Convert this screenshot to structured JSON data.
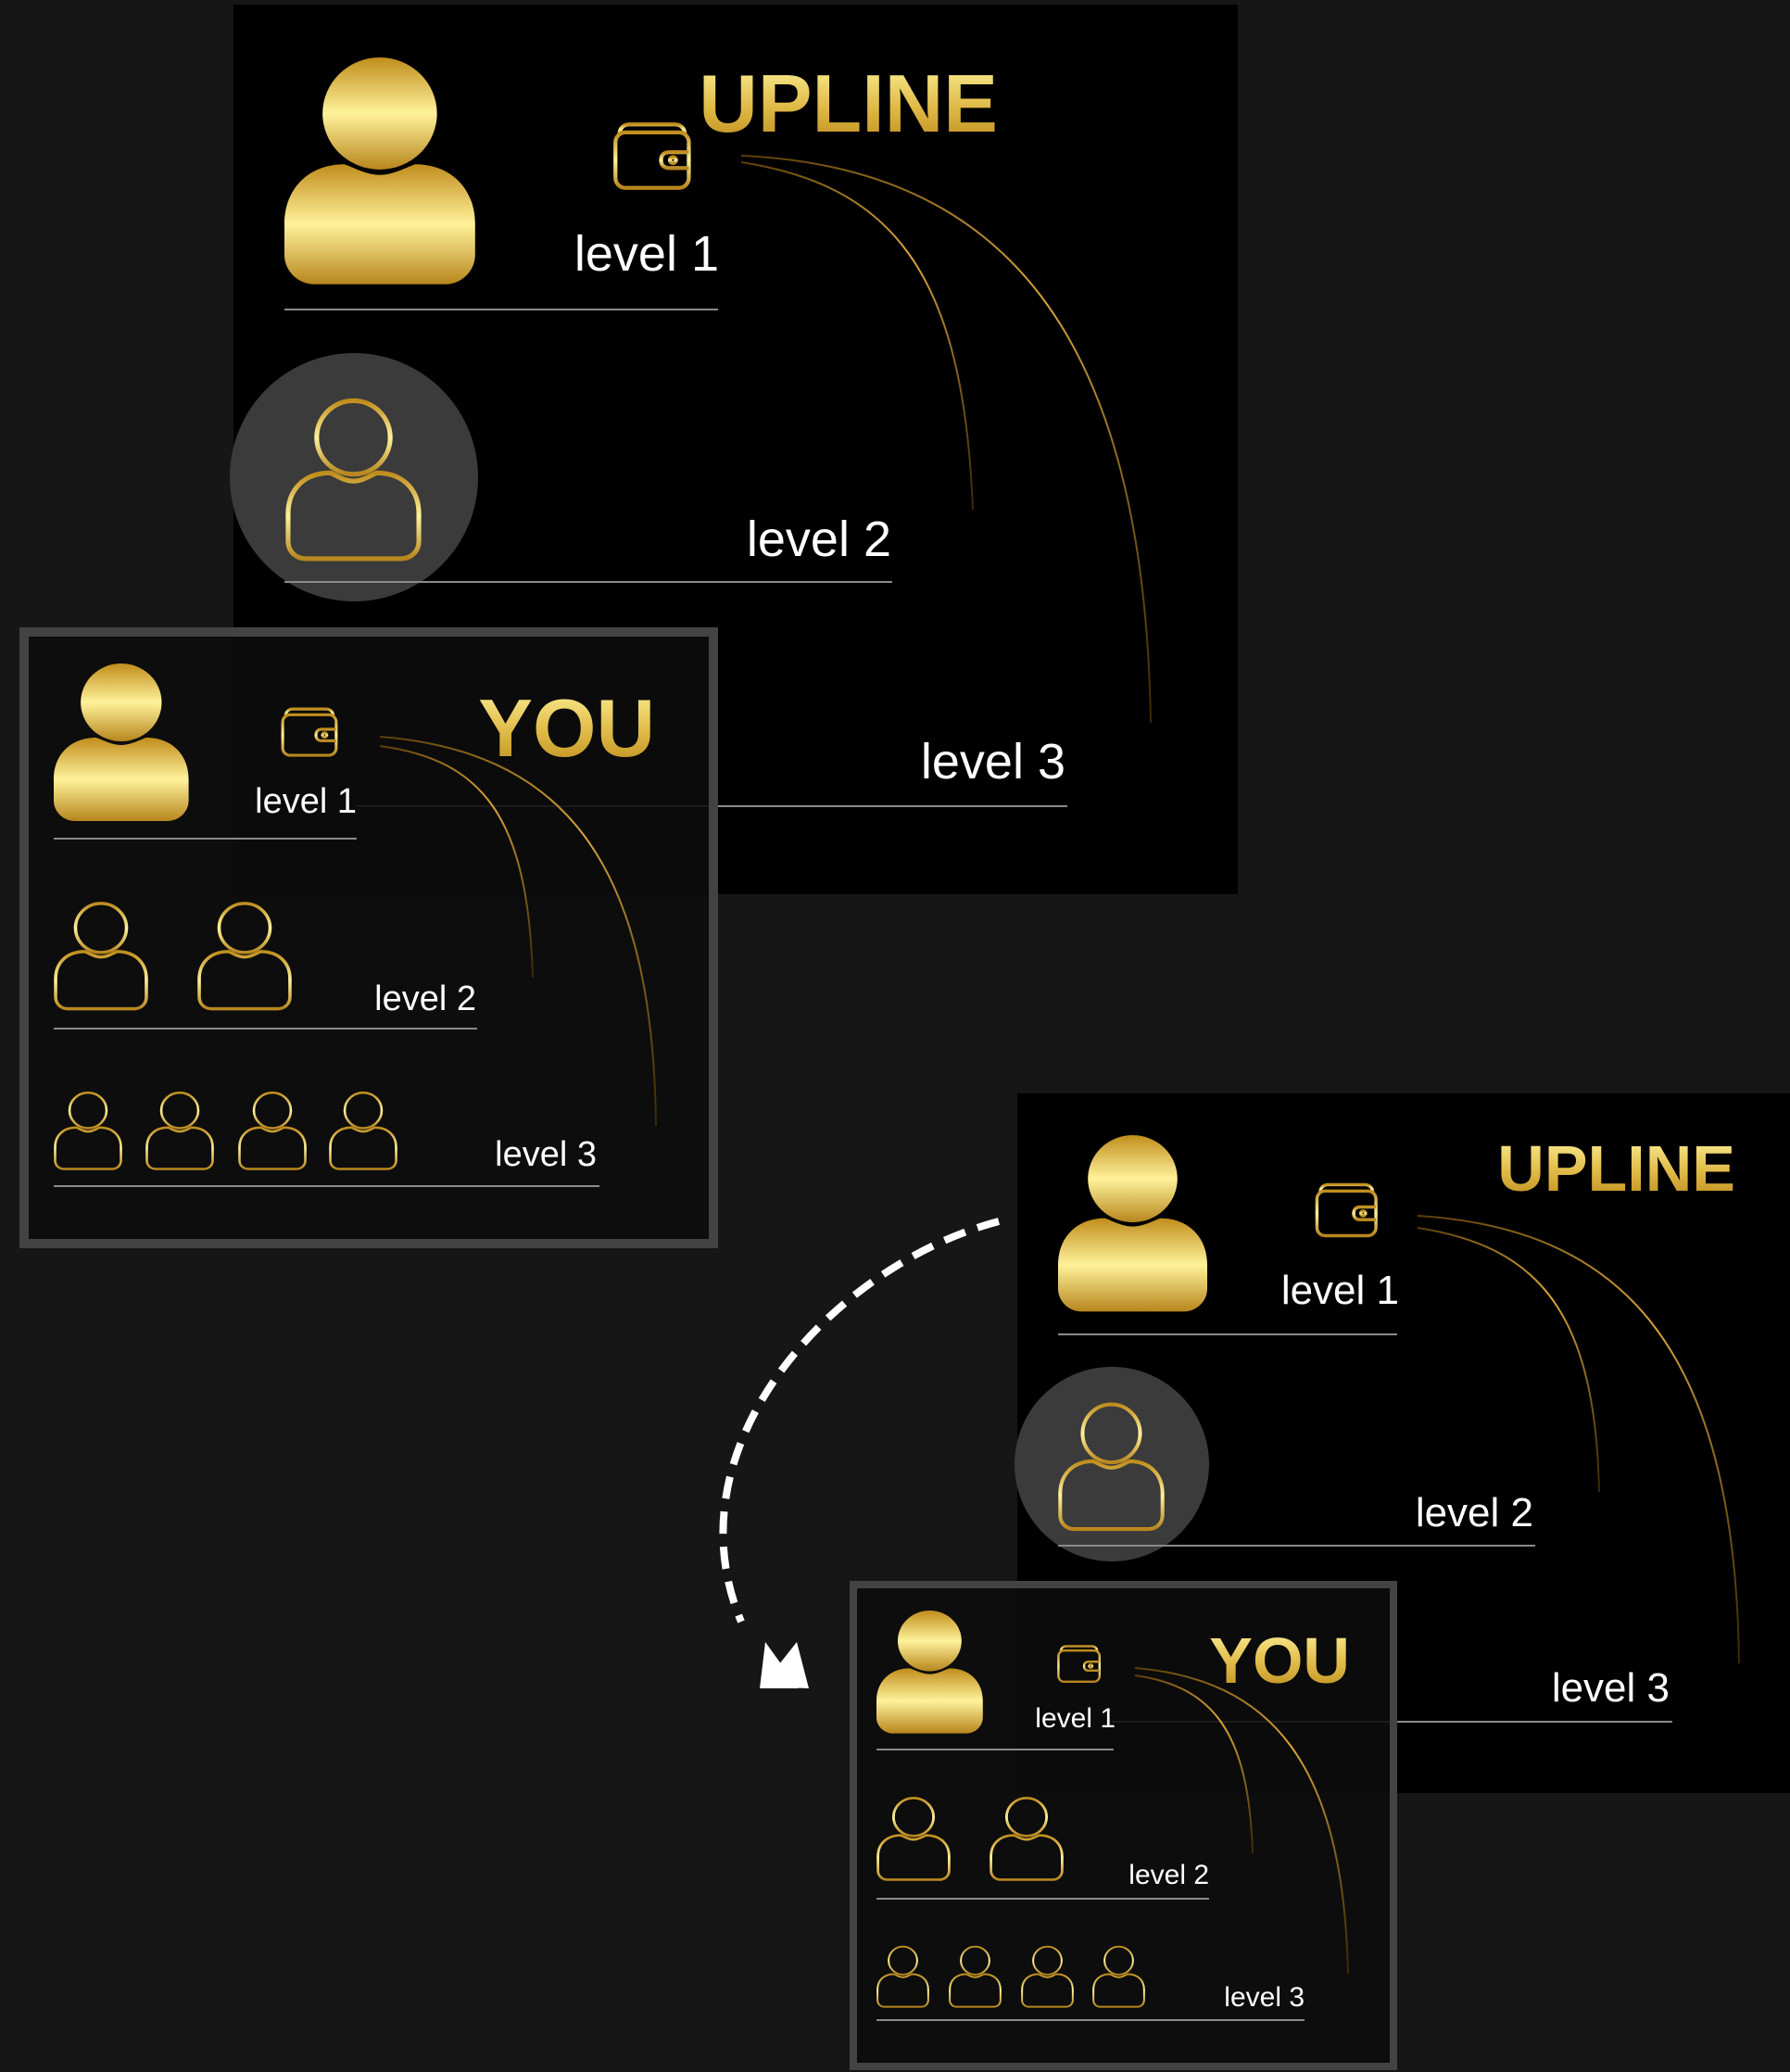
{
  "colors": {
    "background": "#161616",
    "panel": "#000000",
    "gold_light": "#fff29a",
    "gold_dark": "#b88a1e",
    "frame": "#434343"
  },
  "top": {
    "upline": {
      "title": "UPLINE",
      "level1": "level 1",
      "level2": "level 2",
      "level3": "level 3"
    },
    "you": {
      "title": "YOU",
      "level1": "level 1",
      "level2": "level 2",
      "level3": "level 3"
    }
  },
  "bottom": {
    "upline": {
      "title": "UPLINE",
      "level1": "level 1",
      "level2": "level 2",
      "level3": "level 3"
    },
    "you": {
      "title": "YOU",
      "level1": "level 1",
      "level2": "level 2",
      "level3": "level 3"
    }
  },
  "icons": [
    "user-solid-icon",
    "user-outline-icon",
    "wallet-icon",
    "dashed-arrow"
  ]
}
